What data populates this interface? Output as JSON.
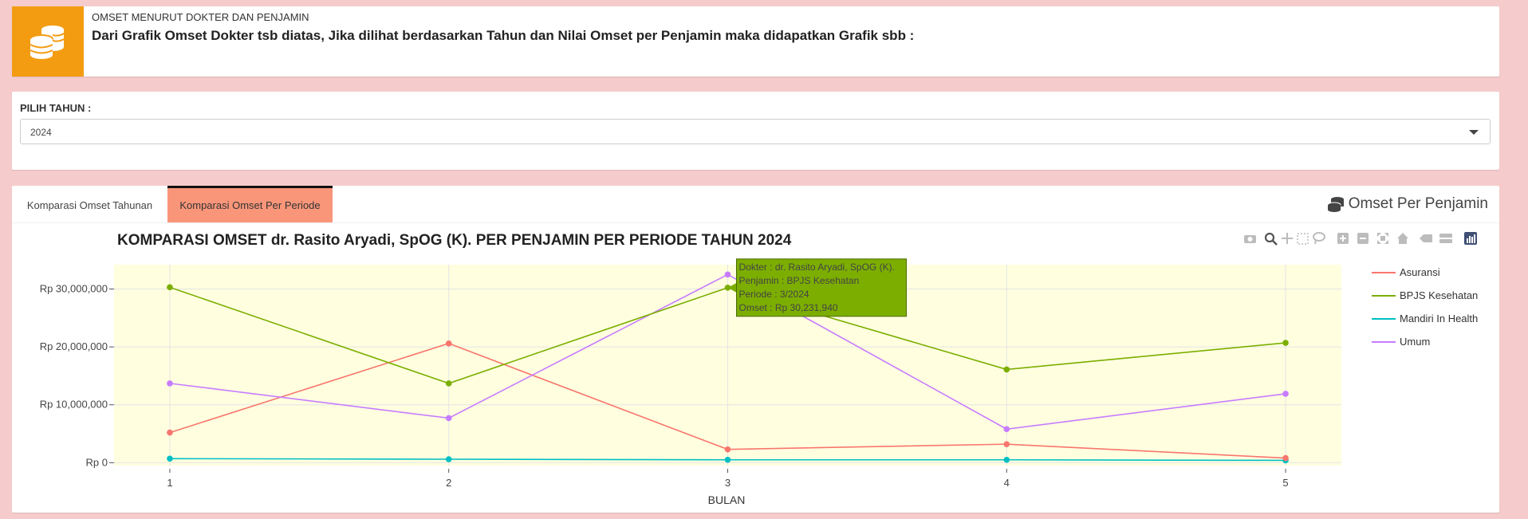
{
  "info": {
    "small": "OMSET MENURUT DOKTER DAN PENJAMIN",
    "big": "Dari Grafik Omset Dokter tsb diatas, Jika dilihat berdasarkan Tahun dan Nilai Omset per Penjamin maka didapatkan Grafik sbb :",
    "icon": "coins-icon",
    "icon_color": "#f39c12"
  },
  "year_filter": {
    "label": "PILIH TAHUN :",
    "value": "2024"
  },
  "tabs": [
    {
      "label": "Komparasi Omset Tahunan",
      "active": false
    },
    {
      "label": "Komparasi Omset Per Periode",
      "active": true
    }
  ],
  "panel_title": "Omset Per Penjamin",
  "chart_data": {
    "type": "line",
    "title": "KOMPARASI OMSET dr. Rasito Aryadi, SpOG (K). PER PENJAMIN PER PERIODE TAHUN 2024",
    "xlabel": "BULAN",
    "ylabel": "",
    "x": [
      1,
      2,
      3,
      4,
      5
    ],
    "xticks": [
      "1",
      "2",
      "3",
      "4",
      "5"
    ],
    "yticks": [
      {
        "value": 0,
        "label": "Rp 0"
      },
      {
        "value": 10000000,
        "label": "Rp 10,000,000"
      },
      {
        "value": 20000000,
        "label": "Rp 20,000,000"
      },
      {
        "value": 30000000,
        "label": "Rp 30,000,000"
      }
    ],
    "ylim": [
      -500000,
      34200000
    ],
    "grid": true,
    "plot_bg": "#ffffe0",
    "legend_position": "right",
    "series": [
      {
        "name": "Asuransi",
        "color": "#f8766d",
        "values": [
          5200000,
          20600000,
          2300000,
          3200000,
          800000
        ]
      },
      {
        "name": "BPJS Kesehatan",
        "color": "#7cae00",
        "values": [
          30300000,
          13700000,
          30231940,
          16100000,
          20700000
        ]
      },
      {
        "name": "Mandiri In Health",
        "color": "#00bfc4",
        "values": [
          700000,
          600000,
          500000,
          500000,
          400000
        ]
      },
      {
        "name": "Umum",
        "color": "#c77cff",
        "values": [
          13700000,
          7700000,
          32500000,
          5800000,
          11900000
        ]
      }
    ],
    "tooltip": {
      "lines": [
        "Dokter : dr. Rasito Aryadi, SpOG (K).",
        "Penjamin : BPJS Kesehatan",
        "Periode : 3/2024",
        "Omset : Rp 30,231,940"
      ],
      "series": "BPJS Kesehatan",
      "x": 3,
      "bg": "#7cae00"
    },
    "toolbar_icons": [
      "camera-icon",
      "zoom-icon",
      "pan-icon",
      "box-select-icon",
      "lasso-icon",
      "zoom-in-icon",
      "zoom-out-icon",
      "autoscale-icon",
      "reset-axes-icon",
      "spike-lines-icon",
      "compare-hover-icon",
      "plotly-logo-icon"
    ]
  }
}
